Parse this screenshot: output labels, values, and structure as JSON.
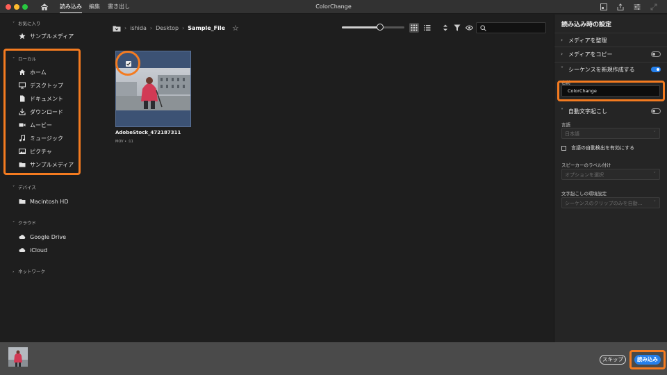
{
  "titlebar": {
    "tabs": [
      {
        "label": "読み込み"
      },
      {
        "label": "編集"
      },
      {
        "label": "書き出し"
      }
    ],
    "window_title": "ColorChange"
  },
  "sidebar": {
    "favorites": {
      "title": "お気に入り",
      "items": [
        {
          "label": "サンプルメディア",
          "icon": "star-icon"
        }
      ]
    },
    "local": {
      "title": "ローカル",
      "items": [
        {
          "label": "ホーム",
          "icon": "home-icon"
        },
        {
          "label": "デスクトップ",
          "icon": "desktop-icon"
        },
        {
          "label": "ドキュメント",
          "icon": "document-icon"
        },
        {
          "label": "ダウンロード",
          "icon": "download-icon"
        },
        {
          "label": "ムービー",
          "icon": "movie-icon"
        },
        {
          "label": "ミュージック",
          "icon": "music-icon"
        },
        {
          "label": "ピクチャ",
          "icon": "picture-icon"
        },
        {
          "label": "サンプルメディア",
          "icon": "folder-icon"
        }
      ]
    },
    "devices": {
      "title": "デバイス",
      "items": [
        {
          "label": "Macintosh HD",
          "icon": "folder-icon"
        }
      ]
    },
    "cloud": {
      "title": "クラウド",
      "items": [
        {
          "label": "Google Drive",
          "icon": "cloud-icon"
        },
        {
          "label": "iCloud",
          "icon": "cloud-icon"
        }
      ]
    },
    "network": {
      "title": "ネットワーク"
    }
  },
  "main": {
    "breadcrumb": [
      "ishida",
      "Desktop",
      "Sample_File"
    ],
    "search": {
      "placeholder": ""
    },
    "file": {
      "name": "AdobeStock_472187311",
      "meta": "MOV • :11",
      "selected": true
    }
  },
  "panel": {
    "title": "読み込み時の設定",
    "rows": {
      "organize": "メディアを整理",
      "copy": "メディアをコピー",
      "new_sequence": "シーケンスを新規作成する",
      "auto_caption": "自動文字起こし"
    },
    "toggles": {
      "copy": false,
      "new_sequence": true,
      "auto_caption": false
    },
    "name_label": "名前",
    "name_value": "ColorChange",
    "language_label": "言語",
    "language_value": "日本語",
    "auto_detect_label": "言語の自動検出を有効にする",
    "speaker_label": "スピーカーのラベル付け",
    "speaker_value": "オプションを選択",
    "env_label": "文字起こしの環境設定",
    "env_value": "シーケンスのクリップのみを自動…"
  },
  "footer": {
    "skip_label": "スキップ",
    "import_label": "読み込み"
  },
  "colors": {
    "accent": "#2680eb",
    "highlight": "#f47b20",
    "selected_card": "#3c5274"
  }
}
